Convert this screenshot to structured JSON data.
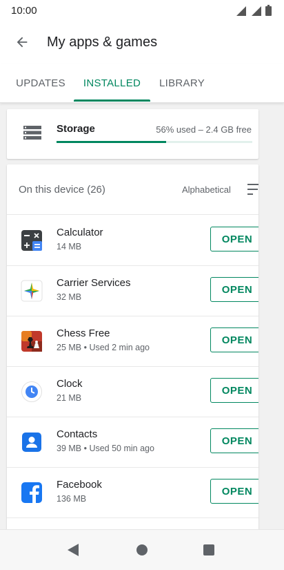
{
  "status_bar": {
    "time": "10:00"
  },
  "app_bar": {
    "title": "My apps & games"
  },
  "tabs": [
    {
      "label": "UPDATES",
      "active": false
    },
    {
      "label": "INSTALLED",
      "active": true
    },
    {
      "label": "LIBRARY",
      "active": false
    }
  ],
  "storage": {
    "label": "Storage",
    "usage_text": "56% used – 2.4 GB free",
    "used_percent": 56
  },
  "device": {
    "header": "On this device (26)",
    "sort_label": "Alphabetical"
  },
  "apps": [
    {
      "name": "Calculator",
      "meta": "14 MB",
      "button": "OPEN",
      "icon": "calculator-icon"
    },
    {
      "name": "Carrier Services",
      "meta": "32 MB",
      "button": "OPEN",
      "icon": "carrier-services-icon"
    },
    {
      "name": "Chess Free",
      "meta": "25 MB • Used 2 min ago",
      "button": "OPEN",
      "icon": "chess-icon"
    },
    {
      "name": "Clock",
      "meta": "21 MB",
      "button": "OPEN",
      "icon": "clock-icon"
    },
    {
      "name": "Contacts",
      "meta": "39 MB • Used 50 min ago",
      "button": "OPEN",
      "icon": "contacts-icon"
    },
    {
      "name": "Facebook",
      "meta": "136 MB",
      "button": "OPEN",
      "icon": "facebook-icon"
    }
  ],
  "colors": {
    "accent": "#01875f",
    "text_primary": "#202124",
    "text_secondary": "#5f6368"
  }
}
